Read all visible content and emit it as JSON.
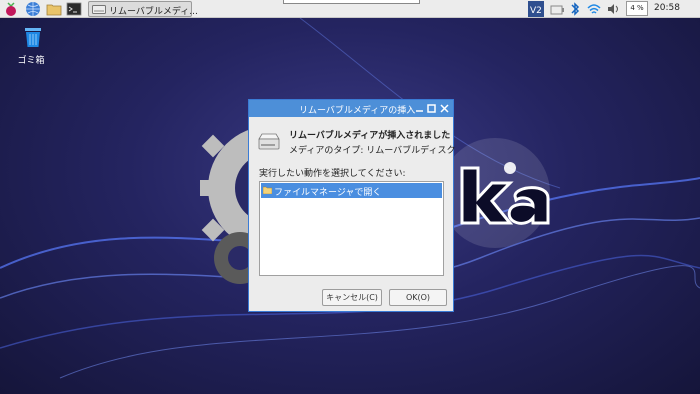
{
  "taskbar": {
    "task_label": "リムーバブルメディ...",
    "cpu": "4 %",
    "clock": "20:58"
  },
  "desktop": {
    "trash_label": "ゴミ箱"
  },
  "dialog": {
    "title": "リムーバブルメディアの挿入",
    "heading": "リムーバブルメディアが挿入されました",
    "media_type": "メディアのタイプ: リムーバブルディスク",
    "prompt": "実行したい動作を選択してください:",
    "actions": [
      "ファイルマネージャで開く"
    ],
    "cancel_label": "キャンセル(C)",
    "ok_label": "OK(O)"
  },
  "colors": {
    "titlebar": "#4d8fd8",
    "selection": "#4a8ee0",
    "panel": "#ececec"
  }
}
